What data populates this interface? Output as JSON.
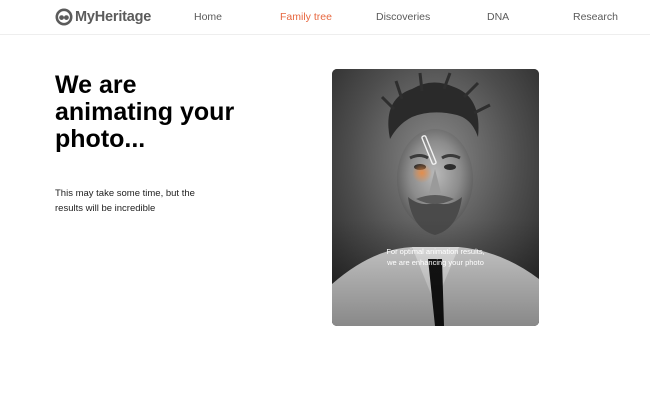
{
  "header": {
    "logo_text": "MyHeritage",
    "nav": [
      {
        "label": "Home",
        "active": false
      },
      {
        "label": "Family tree",
        "active": true
      },
      {
        "label": "Discoveries",
        "active": false
      },
      {
        "label": "DNA",
        "active": false
      },
      {
        "label": "Research",
        "active": false
      }
    ]
  },
  "main": {
    "headline": "We are animating your photo...",
    "subtext": "This may take some time, but the results will be incredible"
  },
  "photo": {
    "overlay_line1": "For optimal animation results,",
    "overlay_line2": "we are enhancing your photo"
  },
  "colors": {
    "accent": "#e7673f",
    "nav_text": "#5a5a5a",
    "logo_text": "#5b5b5b"
  }
}
